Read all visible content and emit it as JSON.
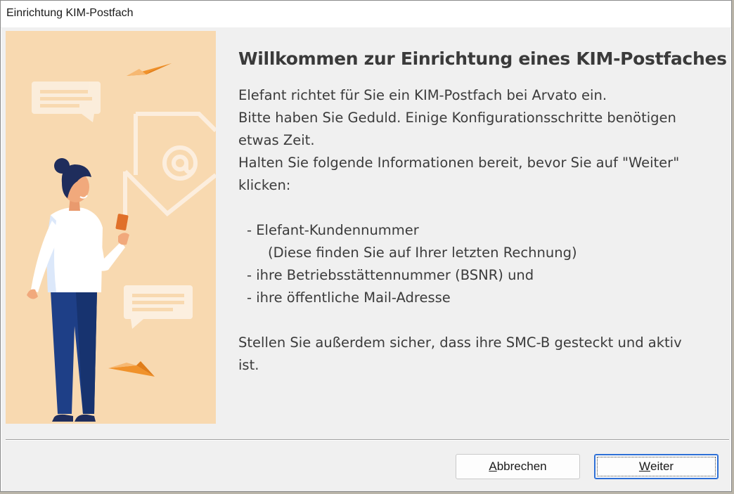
{
  "window": {
    "title": "Einrichtung KIM-Postfach"
  },
  "main": {
    "heading": "Willkommen zur Einrichtung eines KIM-Postfaches",
    "lines": [
      "Elefant richtet für Sie ein KIM-Postfach bei Arvato ein.",
      "Bitte haben Sie Geduld. Einige Konfigurationsschritte benötigen",
      "etwas Zeit.",
      "Halten Sie folgende Informationen bereit, bevor Sie auf \"Weiter\"",
      "klicken:"
    ],
    "list": [
      "- Elefant-Kundennummer",
      "(Diese finden Sie auf Ihrer letzten Rechnung)",
      "- ihre Betriebsstättennummer (BSNR) und",
      "- ihre öffentliche Mail-Adresse"
    ],
    "footer_lines": [
      "Stellen Sie außerdem sicher, dass ihre SMC-B gesteckt und aktiv",
      "ist."
    ]
  },
  "buttons": {
    "cancel": {
      "mnemonic": "A",
      "rest": "bbrechen"
    },
    "next": {
      "mnemonic": "W",
      "rest": "eiter"
    }
  },
  "colors": {
    "illustration_bg": "#f8d9b0",
    "accent_orange": "#f0922b",
    "shirt": "#ffffff",
    "pants": "#1e3f87",
    "hair": "#1f2d5c",
    "default_button_border": "#2d6fd6"
  },
  "icons": [
    "paper-plane-icon",
    "chat-bubble-icon",
    "email-at-icon",
    "person-with-phone-illustration"
  ]
}
